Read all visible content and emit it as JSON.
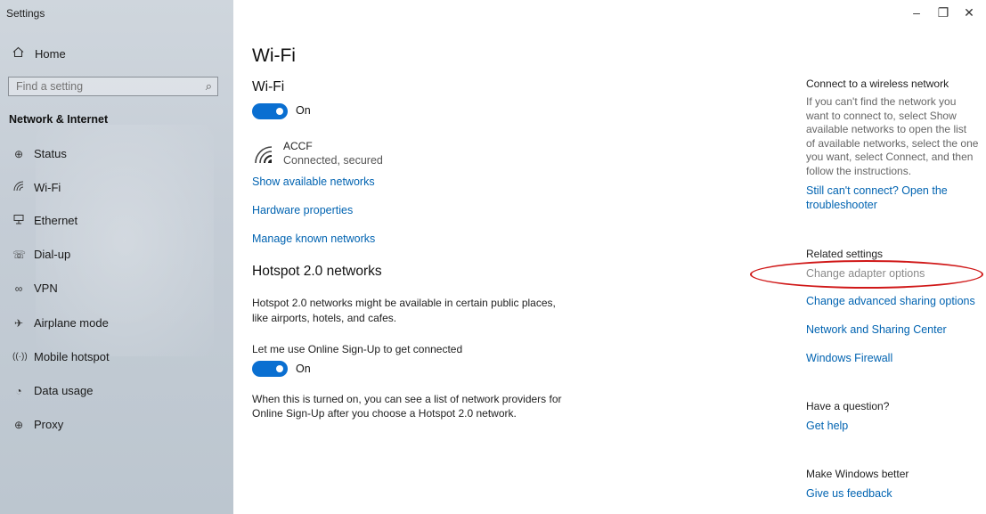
{
  "window": {
    "title": "Settings",
    "minimize_glyph": "–",
    "restore_glyph": "❐",
    "close_glyph": "✕"
  },
  "sidebar": {
    "home_label": "Home",
    "search_placeholder": "Find a setting",
    "section_title": "Network & Internet",
    "items": [
      {
        "label": "Status",
        "icon": "status-icon"
      },
      {
        "label": "Wi-Fi",
        "icon": "wifi-icon"
      },
      {
        "label": "Ethernet",
        "icon": "ethernet-icon"
      },
      {
        "label": "Dial-up",
        "icon": "dialup-icon"
      },
      {
        "label": "VPN",
        "icon": "vpn-icon"
      },
      {
        "label": "Airplane mode",
        "icon": "airplane-icon"
      },
      {
        "label": "Mobile hotspot",
        "icon": "hotspot-icon"
      },
      {
        "label": "Data usage",
        "icon": "data-usage-icon"
      },
      {
        "label": "Proxy",
        "icon": "globe-icon"
      }
    ]
  },
  "main": {
    "title": "Wi-Fi",
    "wifi_heading": "Wi-Fi",
    "wifi_toggle_label": "On",
    "network": {
      "name": "ACCF",
      "status": "Connected, secured"
    },
    "links": {
      "show_networks": "Show available networks",
      "hardware": "Hardware properties",
      "manage_known": "Manage known networks"
    },
    "hotspot": {
      "heading": "Hotspot 2.0 networks",
      "desc_line1": "Hotspot 2.0 networks might be available in certain public places,",
      "desc_line2": "like airports, hotels, and cafes.",
      "online_signup_label": "Let me use Online Sign-Up to get connected",
      "toggle_label": "On",
      "note_line1": "When this is turned on, you can see a list of network providers for",
      "note_line2": "Online Sign-Up after you choose a Hotspot 2.0 network."
    }
  },
  "right_panel": {
    "connect_heading": "Connect to a wireless network",
    "connect_text_lines": [
      "If you can't find the network you",
      "want to connect to, select Show",
      "available networks to open the list",
      "of available networks, select the one",
      "you want, select Connect, and then",
      "follow the instructions."
    ],
    "troubleshoot_line1": "Still can't connect? Open the",
    "troubleshoot_line2": "troubleshooter",
    "related_heading": "Related settings",
    "change_adapter": "Change adapter options",
    "change_sharing": "Change advanced sharing options",
    "network_center": "Network and Sharing Center",
    "firewall": "Windows Firewall",
    "question_heading": "Have a question?",
    "get_help": "Get help",
    "better_heading": "Make Windows better",
    "feedback": "Give us feedback"
  },
  "colors": {
    "accent": "#0063b1",
    "toggle_on": "#0a6fd1",
    "annotation": "#d01818"
  }
}
